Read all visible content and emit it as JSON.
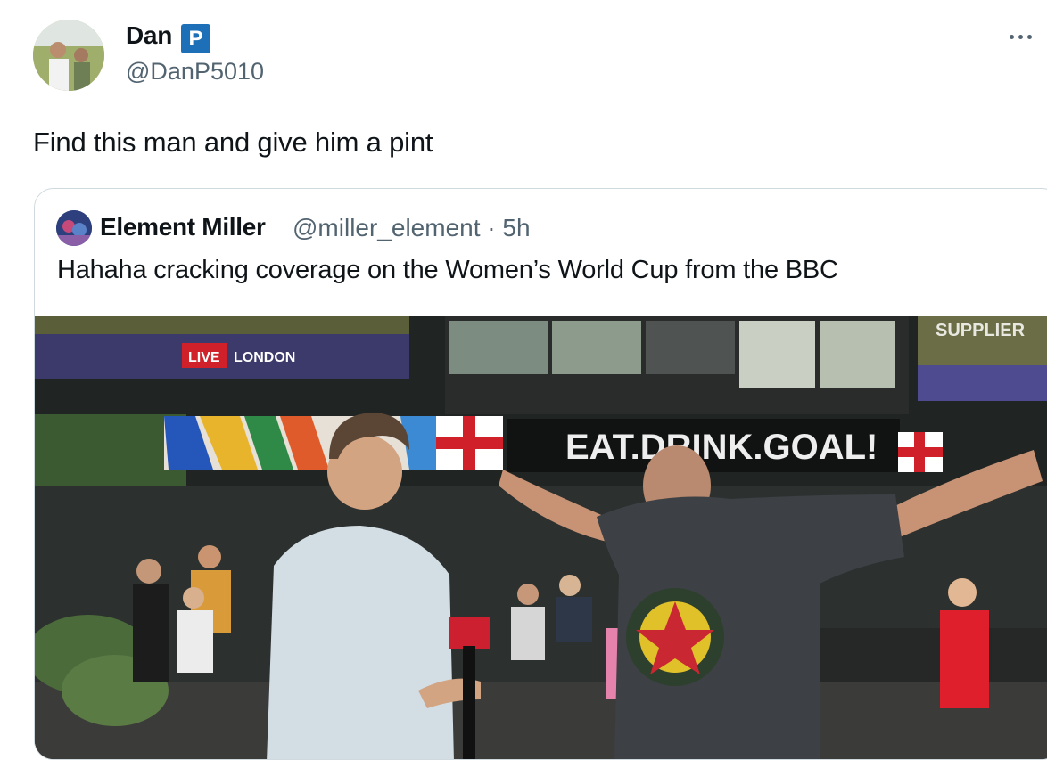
{
  "author": {
    "display_name": "Dan",
    "badge": "P",
    "handle": "@DanP5010"
  },
  "tweet": {
    "text": "Find this man and give him a pint"
  },
  "quoted": {
    "display_name": "Element Miller",
    "handle_time": "@miller_element · 5h",
    "text": "Hahaha cracking coverage on the Women’s World Cup from the BBC",
    "media": {
      "live_label": "LIVE",
      "location_label": "LONDON",
      "banner_text": "EAT.DRINK.GOAL!",
      "supplier_text": "SUPPLIER"
    }
  },
  "icons": {
    "more": "more-horizontal-icon"
  },
  "colors": {
    "badge": "#1d6fb8",
    "secondary_text": "#536471",
    "card_border": "#cfd9de",
    "live_red": "#d0202a"
  }
}
